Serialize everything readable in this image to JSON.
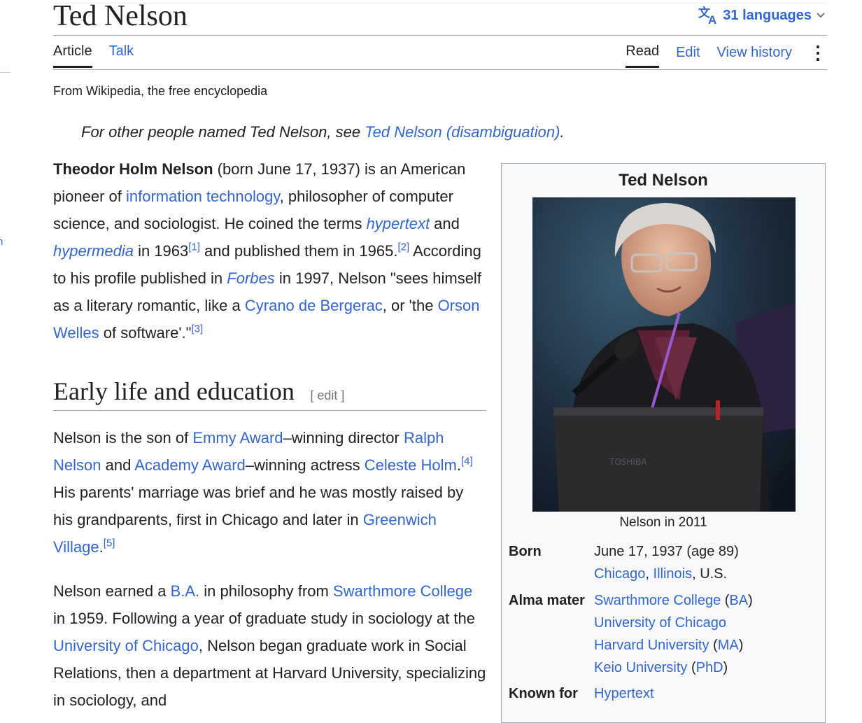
{
  "page": {
    "title": "Ted Nelson",
    "languages_label": "31 languages",
    "tagline": "From Wikipedia, the free encyclopedia"
  },
  "tabs": {
    "left": [
      "Article",
      "Talk"
    ],
    "right": [
      "Read",
      "Edit",
      "View history"
    ]
  },
  "hatnote": {
    "prefix": "For other people named Ted Nelson, see ",
    "link": "Ted Nelson (disambiguation)",
    "suffix": "."
  },
  "intro": {
    "name": "Theodor Holm Nelson",
    "t1": " (born June 17, 1937) is an American pioneer of ",
    "l1": "information technology",
    "t2": ", philosopher of computer science, and sociologist. He coined the terms ",
    "l2": "hypertext",
    "t3": " and ",
    "l3": "hypermedia",
    "t4": " in 1963",
    "r1": "[1]",
    "t5": " and published them in 1965.",
    "r2": "[2]",
    "t6": " According to his profile published in ",
    "l4": "Forbes",
    "t7": " in 1997, Nelson \"sees himself as a literary romantic, like a ",
    "l5": "Cyrano de Bergerac",
    "t8": ", or 'the ",
    "l6": "Orson Welles",
    "t9": " of software'.\"",
    "r3": "[3]"
  },
  "section": {
    "heading": "Early life and education",
    "edit": "[ edit ]"
  },
  "para2": {
    "t1": "Nelson is the son of ",
    "l1": "Emmy Award",
    "t2": "–winning director ",
    "l2": "Ralph Nelson",
    "t3": " and ",
    "l3": "Academy Award",
    "t4": "–winning actress ",
    "l4": "Celeste Holm",
    "t5": ".",
    "r1": "[4]",
    "t6": " His parents' marriage was brief and he was mostly raised by his grandparents, first in Chicago and later in ",
    "l5": "Greenwich Village",
    "t7": ".",
    "r2": "[5]"
  },
  "para3": {
    "t1": "Nelson earned a ",
    "l1": "B.A.",
    "t2": " in philosophy from ",
    "l2": "Swarthmore College",
    "t3": " in 1959. Following a year of graduate study in sociology at the ",
    "l3": "University of Chicago",
    "t4": ", Nelson began graduate work in Social Relations, then a department at Harvard University, specializing in sociology, and"
  },
  "infobox": {
    "title": "Ted Nelson",
    "caption": "Nelson in 2011",
    "born_label": "Born",
    "born_date": "June 17, 1937 (age 89)",
    "born_city": "Chicago",
    "born_state": "Illinois",
    "born_country": ", U.S.",
    "alma_label": "Alma mater",
    "alma1": "Swarthmore College",
    "alma1_deg": "BA",
    "alma2": "University of Chicago",
    "alma3": "Harvard University",
    "alma3_deg": "MA",
    "alma4": "Keio University",
    "alma4_deg": "PhD",
    "known_label": "Known for",
    "known1": "Hypertext"
  },
  "colors": {
    "link": "#3366cc",
    "text": "#202122",
    "rule": "#a2a9b1"
  }
}
